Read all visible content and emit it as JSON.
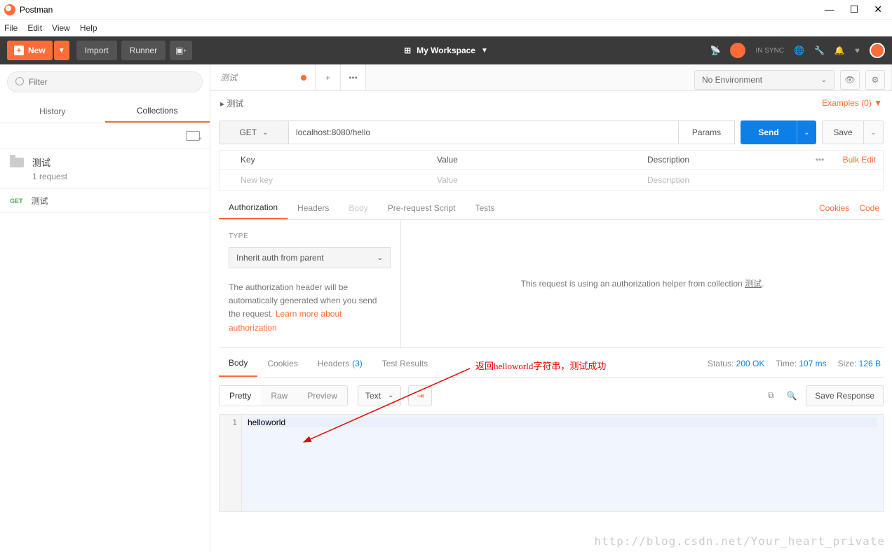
{
  "title": "Postman",
  "menu": {
    "file": "File",
    "edit": "Edit",
    "view": "View",
    "help": "Help"
  },
  "toolbar": {
    "new": "New",
    "import": "Import",
    "runner": "Runner",
    "workspace": "My Workspace",
    "sync": "IN SYNC"
  },
  "sidebar": {
    "filter_placeholder": "Filter",
    "tabs": {
      "history": "History",
      "collections": "Collections"
    },
    "collection": {
      "name": "测试",
      "sub": "1 request"
    },
    "request": {
      "method": "GET",
      "name": "测试"
    }
  },
  "tabs": {
    "active": "测试",
    "env": "No Environment"
  },
  "breadcrumb": {
    "path": "测试",
    "examples": "Examples (0)"
  },
  "url": {
    "method": "GET",
    "value": "localhost:8080/hello",
    "params": "Params",
    "send": "Send",
    "save": "Save"
  },
  "params_head": {
    "key": "Key",
    "value": "Value",
    "desc": "Description",
    "bulk": "Bulk Edit"
  },
  "params_ph": {
    "key": "New key",
    "value": "Value",
    "desc": "Description"
  },
  "req_tabs": {
    "auth": "Authorization",
    "headers": "Headers",
    "body": "Body",
    "pre": "Pre-request Script",
    "tests": "Tests",
    "cookies": "Cookies",
    "code": "Code"
  },
  "auth": {
    "type_label": "TYPE",
    "type_value": "Inherit auth from parent",
    "desc1": "The authorization header will be automatically generated when you send the request. ",
    "learn": "Learn more about authorization",
    "right": "This request is using an authorization helper from collection ",
    "right_link": "测试"
  },
  "resp_tabs": {
    "body": "Body",
    "cookies": "Cookies",
    "headers": "Headers",
    "headers_count": "(3)",
    "tests": "Test Results"
  },
  "status": {
    "status_l": "Status:",
    "status_v": "200 OK",
    "time_l": "Time:",
    "time_v": "107 ms",
    "size_l": "Size:",
    "size_v": "126 B"
  },
  "views": {
    "pretty": "Pretty",
    "raw": "Raw",
    "preview": "Preview",
    "fmt": "Text",
    "save_resp": "Save Response"
  },
  "response": {
    "line1_num": "1",
    "line1": "helloworld"
  },
  "annotation": "返回helloworld字符串，测试成功",
  "watermark": "http://blog.csdn.net/Your_heart_private"
}
